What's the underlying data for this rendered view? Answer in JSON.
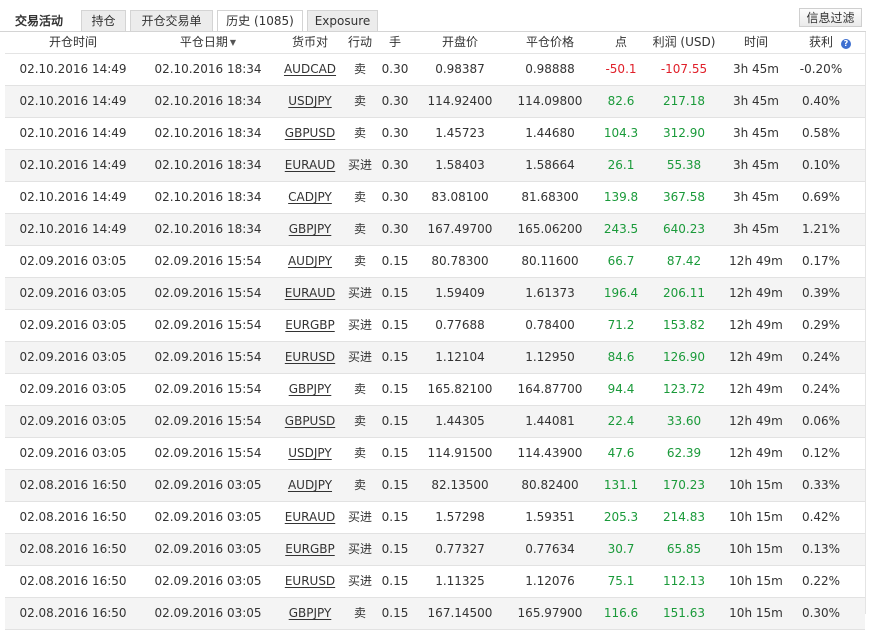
{
  "header": {
    "section_title": "交易活动",
    "tabs": [
      {
        "label": "持仓"
      },
      {
        "label": "开仓交易单"
      },
      {
        "label": "历史 (1085)"
      },
      {
        "label": "Exposure"
      }
    ],
    "filter_label": "信息过滤"
  },
  "columns": {
    "open_time": "开仓时间",
    "close_date": "平仓日期",
    "symbol": "货币对",
    "action": "行动",
    "volume": "手",
    "open_price": "开盘价",
    "close_price": "平仓价格",
    "points": "点",
    "profit": "利润 (USD)",
    "time": "时间",
    "gain": "获利",
    "help_icon": "?"
  },
  "colors": {
    "positive": "#1a9a3a",
    "negative": "#e0202a"
  },
  "rows": [
    {
      "open_time": "02.10.2016 14:49",
      "close_date": "02.10.2016 18:34",
      "symbol": "AUDCAD",
      "action": "卖",
      "volume": "0.30",
      "open_price": "0.98387",
      "close_price": "0.98888",
      "points": "-50.1",
      "profit": "-107.55",
      "time": "3h 45m",
      "gain": "-0.20%",
      "sign": "neg"
    },
    {
      "open_time": "02.10.2016 14:49",
      "close_date": "02.10.2016 18:34",
      "symbol": "USDJPY",
      "action": "卖",
      "volume": "0.30",
      "open_price": "114.92400",
      "close_price": "114.09800",
      "points": "82.6",
      "profit": "217.18",
      "time": "3h 45m",
      "gain": "0.40%",
      "sign": "pos"
    },
    {
      "open_time": "02.10.2016 14:49",
      "close_date": "02.10.2016 18:34",
      "symbol": "GBPUSD",
      "action": "卖",
      "volume": "0.30",
      "open_price": "1.45723",
      "close_price": "1.44680",
      "points": "104.3",
      "profit": "312.90",
      "time": "3h 45m",
      "gain": "0.58%",
      "sign": "pos"
    },
    {
      "open_time": "02.10.2016 14:49",
      "close_date": "02.10.2016 18:34",
      "symbol": "EURAUD",
      "action": "买进",
      "volume": "0.30",
      "open_price": "1.58403",
      "close_price": "1.58664",
      "points": "26.1",
      "profit": "55.38",
      "time": "3h 45m",
      "gain": "0.10%",
      "sign": "pos"
    },
    {
      "open_time": "02.10.2016 14:49",
      "close_date": "02.10.2016 18:34",
      "symbol": "CADJPY",
      "action": "卖",
      "volume": "0.30",
      "open_price": "83.08100",
      "close_price": "81.68300",
      "points": "139.8",
      "profit": "367.58",
      "time": "3h 45m",
      "gain": "0.69%",
      "sign": "pos"
    },
    {
      "open_time": "02.10.2016 14:49",
      "close_date": "02.10.2016 18:34",
      "symbol": "GBPJPY",
      "action": "卖",
      "volume": "0.30",
      "open_price": "167.49700",
      "close_price": "165.06200",
      "points": "243.5",
      "profit": "640.23",
      "time": "3h 45m",
      "gain": "1.21%",
      "sign": "pos"
    },
    {
      "open_time": "02.09.2016 03:05",
      "close_date": "02.09.2016 15:54",
      "symbol": "AUDJPY",
      "action": "卖",
      "volume": "0.15",
      "open_price": "80.78300",
      "close_price": "80.11600",
      "points": "66.7",
      "profit": "87.42",
      "time": "12h 49m",
      "gain": "0.17%",
      "sign": "pos"
    },
    {
      "open_time": "02.09.2016 03:05",
      "close_date": "02.09.2016 15:54",
      "symbol": "EURAUD",
      "action": "买进",
      "volume": "0.15",
      "open_price": "1.59409",
      "close_price": "1.61373",
      "points": "196.4",
      "profit": "206.11",
      "time": "12h 49m",
      "gain": "0.39%",
      "sign": "pos"
    },
    {
      "open_time": "02.09.2016 03:05",
      "close_date": "02.09.2016 15:54",
      "symbol": "EURGBP",
      "action": "买进",
      "volume": "0.15",
      "open_price": "0.77688",
      "close_price": "0.78400",
      "points": "71.2",
      "profit": "153.82",
      "time": "12h 49m",
      "gain": "0.29%",
      "sign": "pos"
    },
    {
      "open_time": "02.09.2016 03:05",
      "close_date": "02.09.2016 15:54",
      "symbol": "EURUSD",
      "action": "买进",
      "volume": "0.15",
      "open_price": "1.12104",
      "close_price": "1.12950",
      "points": "84.6",
      "profit": "126.90",
      "time": "12h 49m",
      "gain": "0.24%",
      "sign": "pos"
    },
    {
      "open_time": "02.09.2016 03:05",
      "close_date": "02.09.2016 15:54",
      "symbol": "GBPJPY",
      "action": "卖",
      "volume": "0.15",
      "open_price": "165.82100",
      "close_price": "164.87700",
      "points": "94.4",
      "profit": "123.72",
      "time": "12h 49m",
      "gain": "0.24%",
      "sign": "pos"
    },
    {
      "open_time": "02.09.2016 03:05",
      "close_date": "02.09.2016 15:54",
      "symbol": "GBPUSD",
      "action": "卖",
      "volume": "0.15",
      "open_price": "1.44305",
      "close_price": "1.44081",
      "points": "22.4",
      "profit": "33.60",
      "time": "12h 49m",
      "gain": "0.06%",
      "sign": "pos"
    },
    {
      "open_time": "02.09.2016 03:05",
      "close_date": "02.09.2016 15:54",
      "symbol": "USDJPY",
      "action": "卖",
      "volume": "0.15",
      "open_price": "114.91500",
      "close_price": "114.43900",
      "points": "47.6",
      "profit": "62.39",
      "time": "12h 49m",
      "gain": "0.12%",
      "sign": "pos"
    },
    {
      "open_time": "02.08.2016 16:50",
      "close_date": "02.09.2016 03:05",
      "symbol": "AUDJPY",
      "action": "卖",
      "volume": "0.15",
      "open_price": "82.13500",
      "close_price": "80.82400",
      "points": "131.1",
      "profit": "170.23",
      "time": "10h 15m",
      "gain": "0.33%",
      "sign": "pos"
    },
    {
      "open_time": "02.08.2016 16:50",
      "close_date": "02.09.2016 03:05",
      "symbol": "EURAUD",
      "action": "买进",
      "volume": "0.15",
      "open_price": "1.57298",
      "close_price": "1.59351",
      "points": "205.3",
      "profit": "214.83",
      "time": "10h 15m",
      "gain": "0.42%",
      "sign": "pos"
    },
    {
      "open_time": "02.08.2016 16:50",
      "close_date": "02.09.2016 03:05",
      "symbol": "EURGBP",
      "action": "买进",
      "volume": "0.15",
      "open_price": "0.77327",
      "close_price": "0.77634",
      "points": "30.7",
      "profit": "65.85",
      "time": "10h 15m",
      "gain": "0.13%",
      "sign": "pos"
    },
    {
      "open_time": "02.08.2016 16:50",
      "close_date": "02.09.2016 03:05",
      "symbol": "EURUSD",
      "action": "买进",
      "volume": "0.15",
      "open_price": "1.11325",
      "close_price": "1.12076",
      "points": "75.1",
      "profit": "112.13",
      "time": "10h 15m",
      "gain": "0.22%",
      "sign": "pos"
    },
    {
      "open_time": "02.08.2016 16:50",
      "close_date": "02.09.2016 03:05",
      "symbol": "GBPJPY",
      "action": "卖",
      "volume": "0.15",
      "open_price": "167.14500",
      "close_price": "165.97900",
      "points": "116.6",
      "profit": "151.63",
      "time": "10h 15m",
      "gain": "0.30%",
      "sign": "pos"
    }
  ]
}
